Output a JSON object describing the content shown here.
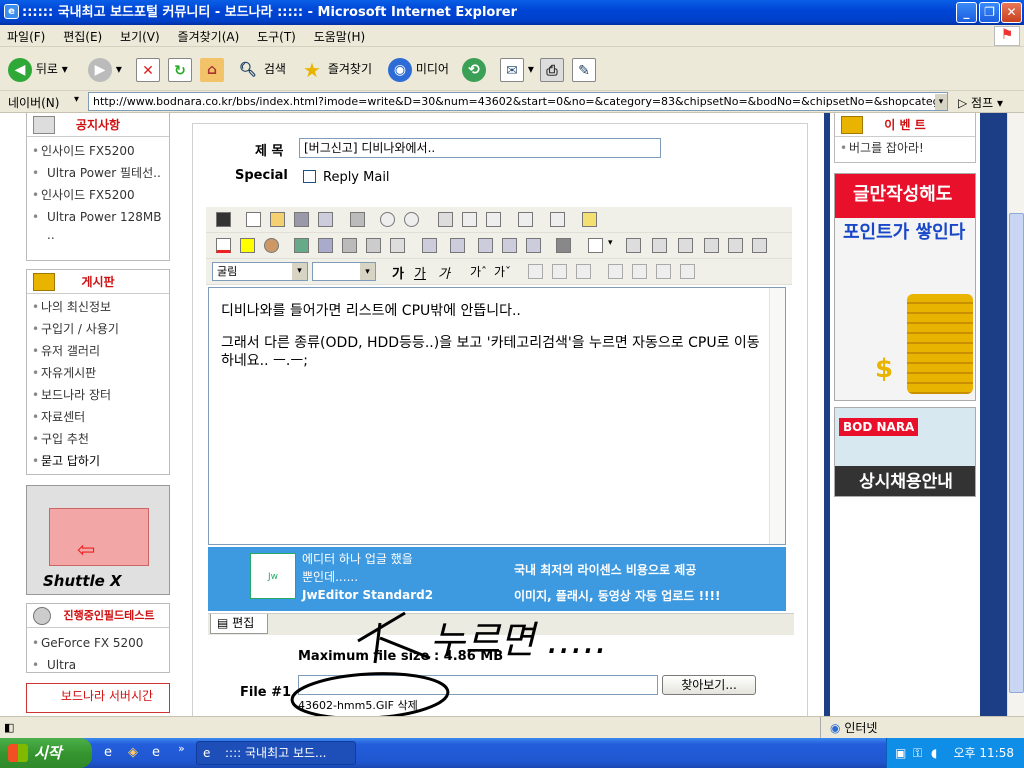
{
  "window": {
    "title": ":::::: 국내최고 보드포털 커뮤니티 - 보드나라 ::::: - Microsoft Internet Explorer"
  },
  "menu": {
    "items": [
      "파일(F)",
      "편집(E)",
      "보기(V)",
      "즐겨찾기(A)",
      "도구(T)",
      "도움말(H)"
    ]
  },
  "toolbar": {
    "back": "뒤로",
    "search": "검색",
    "favorites": "즐겨찾기",
    "media": "미디어"
  },
  "address": {
    "label": "네이버(N)",
    "url": "http://www.bodnara.co.kr/bbs/index.html?imode=write&D=30&num=43602&start=0&no=&category=83&chipsetNo=&bodNo=&chipsetNo=&shopcategory",
    "go": "점프"
  },
  "left": {
    "notice_title": "공지사항",
    "notice_items": [
      "인사이드 FX5200",
      "Ultra Power 필테선..",
      "인사이드 FX5200",
      "Ultra Power 128MB .."
    ],
    "board_title": "게시판",
    "board_items": [
      "나의 최신정보",
      "구입기 / 사용기",
      "유저 갤러리",
      "자유게시판",
      "보드나라 장터",
      "자료센터",
      "구입 추천",
      "묻고 답하기"
    ],
    "ad_brand": "Shuttle X",
    "field_title": "진행중인필드테스트",
    "field_items": [
      "GeForce FX 5200",
      "Ultra"
    ],
    "server_title": "보드나라 서버시간"
  },
  "form": {
    "subject_label": "제 목",
    "subject_value": "[버그신고] 디비나와에서..",
    "special_label": "Special",
    "reply_mail": "Reply Mail",
    "font_select": "굴림",
    "body_line1": "디비나와를 들어가면 리스트에 CPU밖에 안뜹니다..",
    "body_line2": "그래서 다른 종류(ODD, HDD등등..)을 보고 '카테고리검색'을 누르면 자동으로 CPU로 이동하네요.. ㅡ.ㅡ;",
    "banner_left1": "에디터 하나 업글 했을",
    "banner_left2": "뿐인데......",
    "banner_product": "JwEditor Standard2",
    "banner_right1": "국내 최저의 라이센스 비용으로 제공",
    "banner_right2": "이미지, 플래시, 동영상 자동 업로드 !!!!",
    "edit_tab": "편집",
    "max_file": "Maximum file size : 4.86 MB",
    "file_label": "File #1",
    "browse": "찾아보기...",
    "attached": "43602-hmm5.GIF 삭제",
    "scribble": "누르면 ....."
  },
  "right": {
    "event_title": "이 벤 트",
    "event_item": "버그를 잡아라!",
    "ad1_line1": "글만작성해도",
    "ad1_line2": "포인트가 쌓인다",
    "ad2_brand": "BOD NARA",
    "ad2_text": "상시채용안내"
  },
  "status": {
    "zone": "인터넷"
  },
  "taskbar": {
    "start": "시작",
    "item": ":::: 국내최고 보드...",
    "clock": "오후 11:58"
  }
}
